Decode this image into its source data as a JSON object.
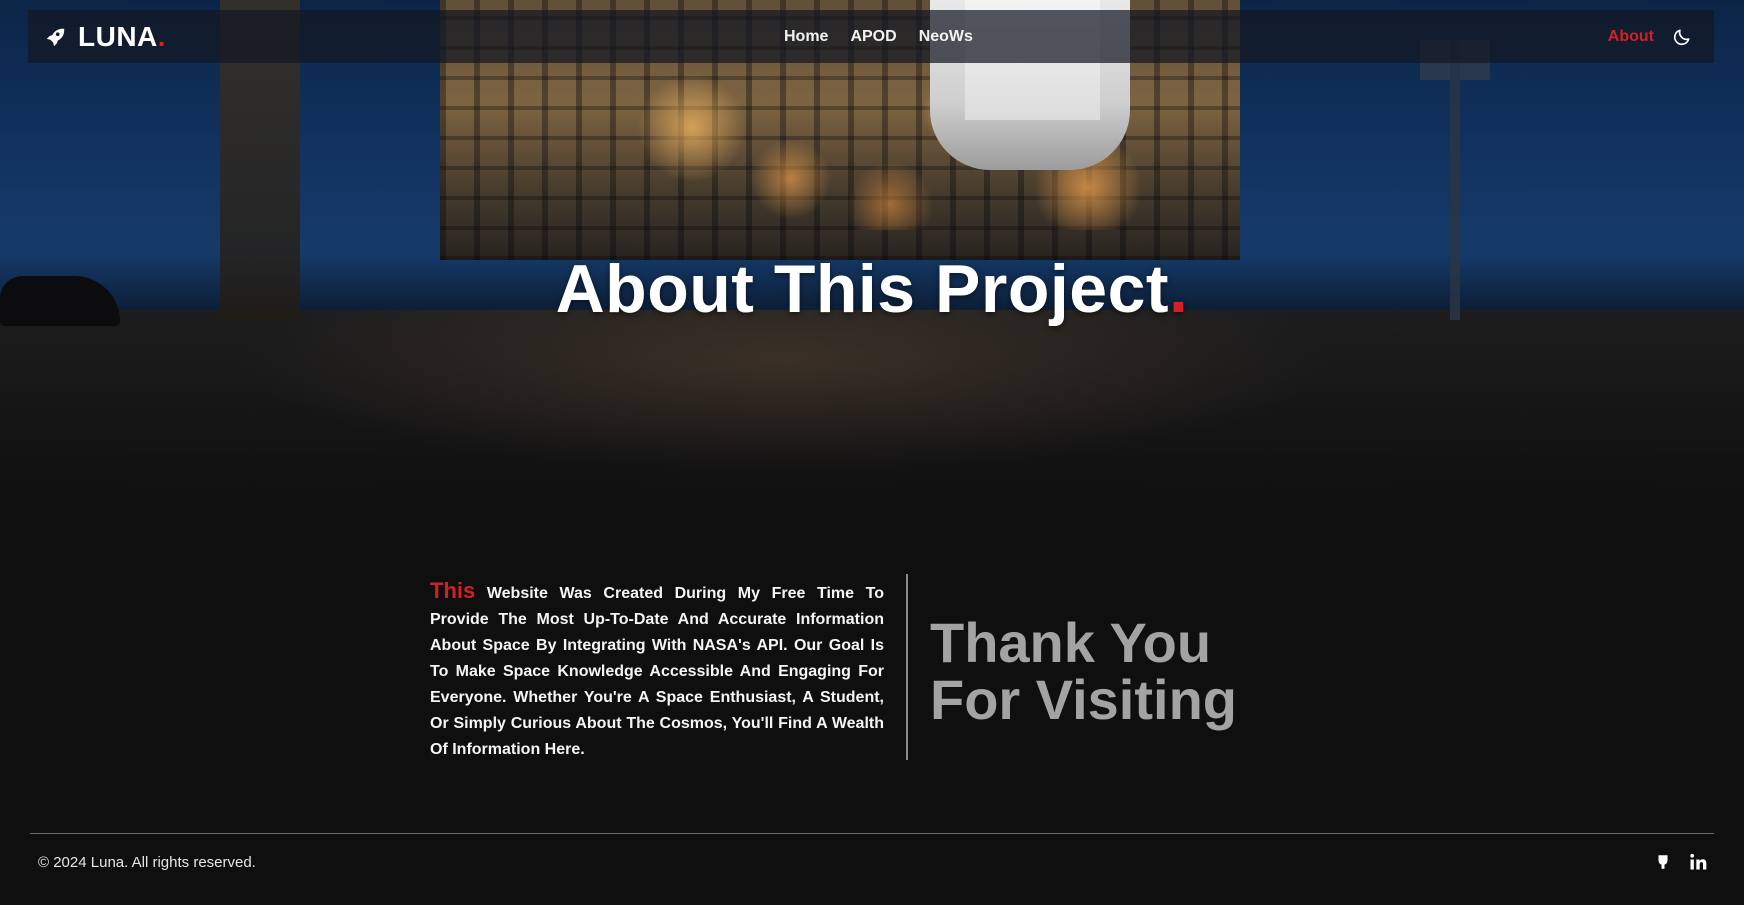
{
  "brand": {
    "name": "LUNA",
    "dot": ".",
    "icon": "rocket-icon",
    "accent_color": "#d22027"
  },
  "nav": {
    "links": [
      "Home",
      "APOD",
      "NeoWs"
    ],
    "about": "About",
    "theme_icon": "moon-icon"
  },
  "hero": {
    "title": "About This Project",
    "title_dot": "."
  },
  "about": {
    "lead": "This",
    "body": " Website Was Created During My Free Time To Provide The Most Up-To-Date And Accurate Information About Space By Integrating With NASA's API. Our Goal Is To Make Space Knowledge Accessible And Engaging For Everyone. Whether You're A Space Enthusiast, A Student, Or Simply Curious About The Cosmos, You'll Find A Wealth Of Information Here."
  },
  "thanks": {
    "line1": "Thank You",
    "line2": "For Visiting"
  },
  "footer": {
    "copyright": "© 2024 Luna. All rights reserved.",
    "icons": [
      "github-icon",
      "linkedin-icon"
    ]
  }
}
